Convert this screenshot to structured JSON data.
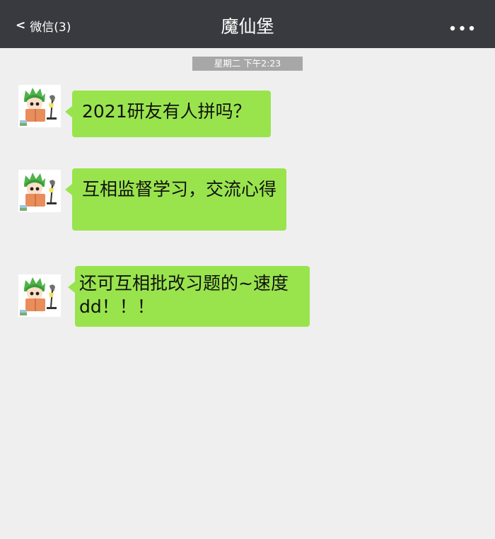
{
  "header": {
    "back_label": "微信(3)",
    "title": "魔仙堡",
    "more_icon": "more-dots-icon"
  },
  "timestamp": "星期二 下午2:23",
  "messages": [
    {
      "text": "2021研友有人拼吗？"
    },
    {
      "text": "互相监督学习，交流心得"
    },
    {
      "text": "还可互相批改习题的~速度dd！！！"
    }
  ],
  "colors": {
    "topbar": "#393a3f",
    "background": "#efefef",
    "bubble": "#99e44d",
    "timestamp_bg": "#a7a7a7"
  }
}
